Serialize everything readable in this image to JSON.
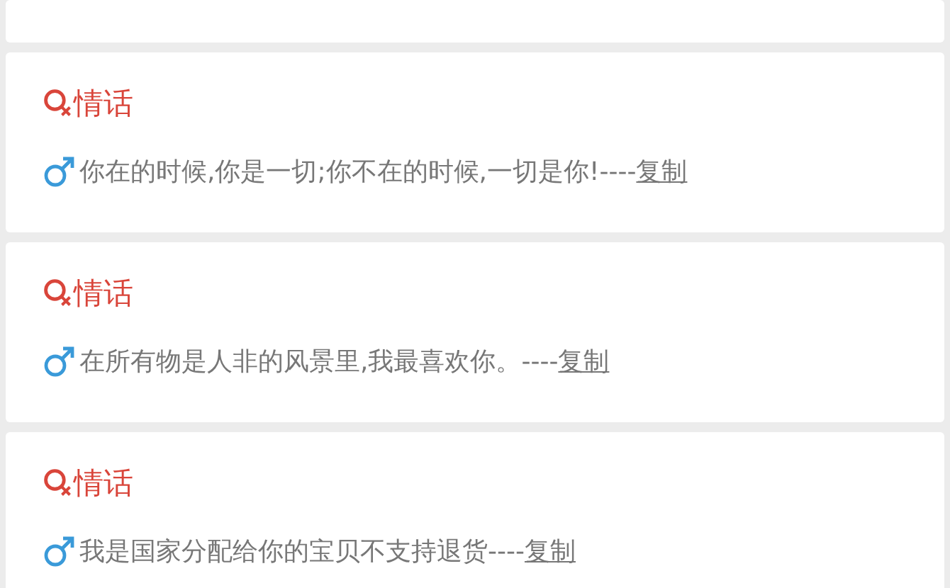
{
  "cards": [
    {
      "title": "情话",
      "text": "你在的时候,你是一切;你不在的时候,一切是你!----",
      "link": "复制"
    },
    {
      "title": "情话",
      "text": "在所有物是人非的风景里,我最喜欢你。----",
      "link": "复制"
    },
    {
      "title": "情话",
      "text": "我是国家分配给你的宝贝不支持退货----",
      "link": "复制"
    }
  ]
}
